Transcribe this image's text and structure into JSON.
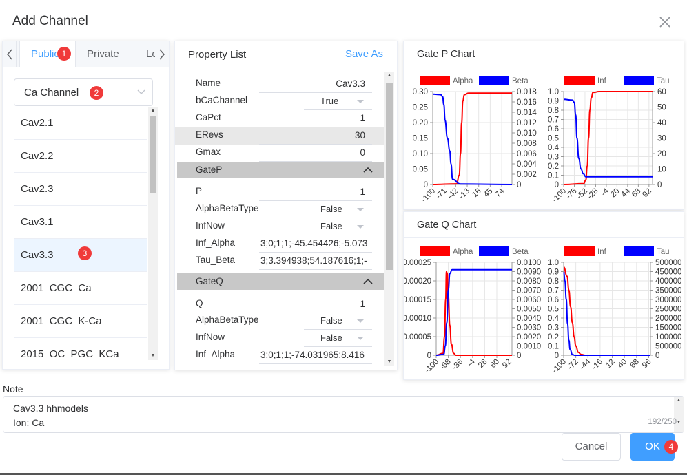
{
  "dialog": {
    "title": "Add Channel",
    "close_icon": "close-icon"
  },
  "left_panel": {
    "tabs": [
      {
        "label": "Public",
        "active": true
      },
      {
        "label": "Private",
        "active": false
      },
      {
        "label": "Lo",
        "active": false
      }
    ],
    "select_value": "Ca Channel",
    "channels": [
      "Cav2.1",
      "Cav2.2",
      "Cav2.3",
      "Cav3.1",
      "Cav3.3",
      "2001_CGC_Ca",
      "2001_CGC_K-Ca",
      "2015_OC_PGC_KCa"
    ],
    "selected_channel": "Cav3.3"
  },
  "badges": {
    "b1": "1",
    "b2": "2",
    "b3": "3",
    "b4": "4"
  },
  "property_list": {
    "title": "Property List",
    "save_as": "Save As",
    "rows": [
      {
        "label": "Name",
        "value": "Cav3.3"
      },
      {
        "label": "bCaChannel",
        "value": "True"
      },
      {
        "label": "CaPct",
        "value": "1"
      },
      {
        "label": "ERevs",
        "value": "30"
      },
      {
        "label": "Gmax",
        "value": "0"
      }
    ],
    "gate_p": {
      "label": "GateP",
      "rows": [
        {
          "label": "P",
          "value": "1"
        },
        {
          "label": "AlphaBetaType",
          "value": "False"
        },
        {
          "label": "InfNow",
          "value": "False"
        },
        {
          "label": "Inf_Alpha",
          "value": "3;0;1;1;-45.454426;-5.073"
        },
        {
          "label": "Tau_Beta",
          "value": "3;3.394938;54.187616;1;-"
        }
      ]
    },
    "gate_q": {
      "label": "GateQ",
      "rows": [
        {
          "label": "Q",
          "value": "1"
        },
        {
          "label": "AlphaBetaType",
          "value": "False"
        },
        {
          "label": "InfNow",
          "value": "False"
        },
        {
          "label": "Inf_Alpha",
          "value": "3;0;1;1;-74.031965;8.416"
        }
      ]
    }
  },
  "chart_data": [
    {
      "panel": "Gate P Chart",
      "type": "line",
      "legend": [
        "Alpha",
        "Beta"
      ],
      "colors": {
        "Alpha": "#ff0000",
        "Beta": "#0000ff"
      },
      "x_ticks": [
        "-100",
        "-71",
        "-42",
        "-13",
        "16",
        "45",
        "74"
      ],
      "y_left_ticks": [
        "0",
        "0.05",
        "0.10",
        "0.15",
        "0.20",
        "0.25",
        "0.30"
      ],
      "y_right_ticks": [
        "0",
        "0.002",
        "0.004",
        "0.006",
        "0.008",
        "0.010",
        "0.012",
        "0.014",
        "0.016",
        "0.018"
      ],
      "xlim": [
        -100,
        100
      ],
      "ylim_left": [
        0,
        0.3
      ],
      "ylim_right": [
        0,
        0.018
      ],
      "series": [
        {
          "name": "Alpha",
          "x": [
            -100,
            -40,
            -33,
            -30,
            -27,
            -24,
            -20,
            -10,
            100
          ],
          "values": [
            0,
            0.002,
            0.03,
            0.1,
            0.2,
            0.27,
            0.29,
            0.295,
            0.295
          ]
        },
        {
          "name": "Beta",
          "x": [
            -100,
            -80,
            -75,
            -72,
            -69,
            -63,
            -57,
            -54,
            -50,
            -30,
            100
          ],
          "values": [
            0.0175,
            0.0174,
            0.017,
            0.0155,
            0.0125,
            0.009,
            0.0065,
            0.004,
            0.001,
            0.0001,
            0
          ]
        }
      ]
    },
    {
      "panel": "Gate P Chart",
      "type": "line",
      "legend": [
        "Inf",
        "Tau"
      ],
      "colors": {
        "Inf": "#ff0000",
        "Tau": "#0000ff"
      },
      "x_ticks": [
        "-100",
        "-76",
        "-52",
        "-28",
        "-4",
        "20",
        "44",
        "68",
        "92"
      ],
      "y_left_ticks": [
        "0",
        "0.1",
        "0.2",
        "0.3",
        "0.4",
        "0.5",
        "0.6",
        "0.7",
        "0.8",
        "0.9",
        "1.0"
      ],
      "y_right_ticks": [
        "0",
        "10",
        "20",
        "30",
        "40",
        "50",
        "60"
      ],
      "xlim": [
        -100,
        100
      ],
      "ylim_left": [
        0,
        1
      ],
      "ylim_right": [
        0,
        60
      ],
      "series": [
        {
          "name": "Inf",
          "x": [
            -100,
            -55,
            -50,
            -47,
            -44,
            -41,
            -38,
            -34,
            -20,
            100
          ],
          "values": [
            0,
            0.01,
            0.05,
            0.2,
            0.5,
            0.8,
            0.93,
            0.99,
            1.0,
            1.0
          ]
        },
        {
          "name": "Tau",
          "x": [
            -100,
            -80,
            -76,
            -73,
            -70,
            -66,
            -61,
            -56,
            -50,
            100
          ],
          "values": [
            55,
            54.5,
            53,
            45,
            30,
            17,
            10,
            7,
            5,
            5
          ]
        }
      ]
    },
    {
      "panel": "Gate Q Chart",
      "type": "line",
      "legend": [
        "Alpha",
        "Beta"
      ],
      "colors": {
        "Alpha": "#ff0000",
        "Beta": "#0000ff"
      },
      "x_ticks": [
        "-100",
        "-68",
        "-36",
        "-4",
        "28",
        "60",
        "92"
      ],
      "y_left_ticks": [
        "0",
        "0.00005",
        "0.00010",
        "0.00015",
        "0.00020",
        "0.00025"
      ],
      "y_right_ticks": [
        "0",
        "0.0010",
        "0.0020",
        "0.0030",
        "0.0040",
        "0.0050",
        "0.0060",
        "0.0070",
        "0.0080",
        "0.0090",
        "0.0100"
      ],
      "xlim": [
        -100,
        100
      ],
      "ylim_left": [
        0,
        0.00025
      ],
      "ylim_right": [
        0,
        0.01
      ],
      "series": [
        {
          "name": "Alpha",
          "x": [
            -100,
            -82,
            -78,
            -75,
            -73,
            -71,
            -68,
            -64,
            -60,
            -54,
            -48,
            100
          ],
          "values": [
            0,
            5e-06,
            5e-05,
            0.00015,
            0.000225,
            0.00022,
            0.00016,
            8e-05,
            3e-05,
            5e-06,
            0,
            0
          ]
        },
        {
          "name": "Beta",
          "x": [
            -100,
            -80,
            -76,
            -72,
            -68,
            -64,
            -58,
            -50,
            100
          ],
          "values": [
            0,
            0.0001,
            0.001,
            0.0035,
            0.007,
            0.0088,
            0.0092,
            0.0092,
            0.0092
          ]
        }
      ]
    },
    {
      "panel": "Gate Q Chart",
      "type": "line",
      "legend": [
        "Inf",
        "Tau"
      ],
      "colors": {
        "Inf": "#ff0000",
        "Tau": "#0000ff"
      },
      "x_ticks": [
        "-100",
        "-72",
        "-44",
        "-16",
        "12",
        "40",
        "68",
        "96"
      ],
      "y_left_ticks": [
        "0",
        "0.1",
        "0.2",
        "0.3",
        "0.4",
        "0.5",
        "0.6",
        "0.7",
        "0.8",
        "0.9",
        "1.0"
      ],
      "y_right_ticks": [
        "0",
        "500000",
        "100000",
        "150000",
        "200000",
        "250000",
        "300000",
        "350000",
        "400000",
        "450000",
        "500000"
      ],
      "xlim": [
        -100,
        100
      ],
      "ylim_left": [
        0,
        1
      ],
      "ylim_right": [
        0,
        500000
      ],
      "series": [
        {
          "name": "Inf",
          "x": [
            -100,
            -92,
            -88,
            -84,
            -80,
            -76,
            -72,
            -66,
            -60,
            -50,
            100
          ],
          "values": [
            0.95,
            0.85,
            0.7,
            0.52,
            0.35,
            0.2,
            0.1,
            0.03,
            0.008,
            0,
            0
          ]
        },
        {
          "name": "Tau",
          "x": [
            -100,
            -97,
            -94,
            -91,
            -88,
            -85,
            -80,
            -75,
            100
          ],
          "values": [
            450000,
            400000,
            300000,
            170000,
            80000,
            30000,
            5000,
            0,
            0
          ]
        }
      ]
    }
  ],
  "gate_p_chart_title": "Gate P Chart",
  "gate_q_chart_title": "Gate Q Chart",
  "note": {
    "label": "Note",
    "line1": "Cav3.3 hhmodels",
    "line2": "Ion: Ca",
    "count": "192/250"
  },
  "buttons": {
    "cancel": "Cancel",
    "ok": "OK"
  }
}
